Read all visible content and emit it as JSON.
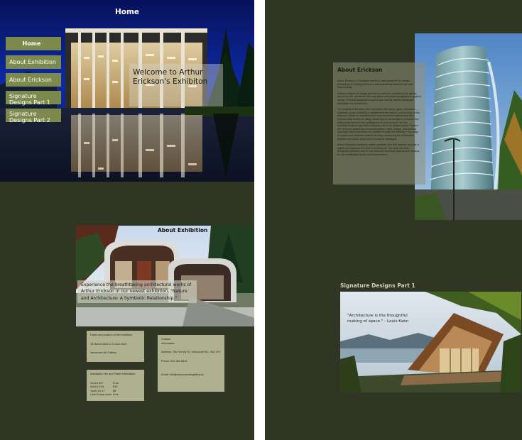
{
  "home": {
    "title": "Home",
    "nav": [
      "Home",
      "About Exhibition",
      "About Erickson",
      "Signature Designs Part 1",
      "Signature Designs Part 2"
    ],
    "welcome": "Welcome to Arthur Erickson's Exhibiton"
  },
  "exhibition": {
    "title": "About Exhibition",
    "intro": "Experience the breathtaking architectural works of Arthur Erickson in our newest exhibition, \"Nature and Architecture: A Symbiotic Relationship.\"",
    "dates_card": {
      "heading": "Dates and location of the exhibition",
      "dates": "18 March 2023 to 3 June 2023",
      "venue": "Vancouver Art Gallery"
    },
    "fees_card": {
      "heading": "Admission Fee and Ticket Information",
      "rows": [
        {
          "label": "Senior 65+",
          "price": "Free"
        },
        {
          "label": "Adult 19-64",
          "price": "$10"
        },
        {
          "label": "Youth 10-17",
          "price": "$5"
        },
        {
          "label": "Child 9 and under",
          "price": "Free"
        }
      ]
    },
    "contact_card": {
      "heading": "Contact Information",
      "address": "Address: 750 Hornby St, Vancouver BC, V6Z 2H7",
      "phone": "Phone: 604 382 5510",
      "email": "Email: info@vancouverartgallery.ca"
    }
  },
  "erickson": {
    "title": "About Erickson",
    "paragraphs": [
      "Arthur Erickson, a Canadian architect, was known for his design philosophy of creating structures that seamlessly blended with their surroundings.",
      "Erickson began his design process by carefully considering the genius loci of the site, identical to the way space articulates typography in graphic design. Erickson designed in such a way that the natural landscape articulated his architecture.",
      "The projects of Erickson were fabricated with wood, glass, and stone — materials chosen carefully to complement the natural surroundings of the structure. What he considered the most important material was light. Erickson was known for using natural light in his designs to enhance the relationship between the building and its environment. His first architectural tenet was that of balance, which he defined as the \"rhythm set off by the spatial and structural system, stairs, ledges, and window openings that complement one another through the building\". His usage of rhythm and cadence created harmony, enhancing the relationship between the indoor space and the natural landscape.",
      "Arthur Erickson's illustrious career spanned over five decades and has a significant impact on the field of architecture. His work has been recognized globally, and he has received numerous awards and honours for his contributions to the built environment."
    ]
  },
  "signature": {
    "title": "Signature Designs Part 1",
    "quote": "\"Architecture is the thoughtful making of space.\" - Louis Kahn"
  }
}
